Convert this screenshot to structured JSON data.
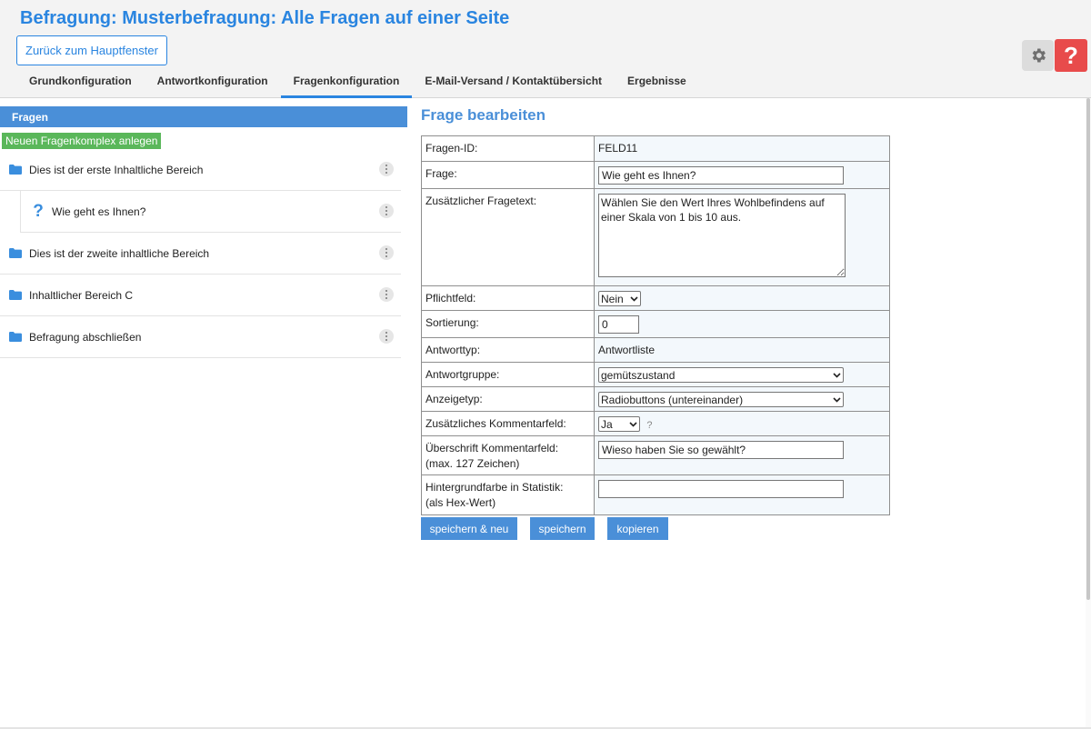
{
  "header": {
    "title": "Befragung: Musterbefragung: Alle Fragen auf einer Seite",
    "back_button": "Zurück zum Hauptfenster",
    "help_label": "?",
    "tabs": [
      {
        "label": "Grundkonfiguration",
        "active": false
      },
      {
        "label": "Antwortkonfiguration",
        "active": false
      },
      {
        "label": "Fragenkonfiguration",
        "active": true
      },
      {
        "label": "E-Mail-Versand / Kontaktübersicht",
        "active": false
      },
      {
        "label": "Ergebnisse",
        "active": false
      }
    ]
  },
  "sidebar": {
    "title": "Fragen",
    "new_button": "Neuen Fragenkomplex anlegen",
    "items": [
      {
        "label": "Dies ist der erste Inhaltliche Bereich",
        "icon": "folder-icon"
      },
      {
        "label": "Wie geht es Ihnen?",
        "icon": "question-icon",
        "child": true,
        "glyph": "?"
      },
      {
        "label": "Dies ist der zweite inhaltliche Bereich",
        "icon": "folder-icon"
      },
      {
        "label": "Inhaltlicher Bereich C",
        "icon": "folder-icon"
      },
      {
        "label": "Befragung abschließen",
        "icon": "folder-icon"
      }
    ]
  },
  "editor": {
    "title": "Frage bearbeiten",
    "rows": {
      "id": {
        "label": "Fragen-ID:",
        "value": "FELD11"
      },
      "question": {
        "label": "Frage:",
        "value": "Wie geht es Ihnen?"
      },
      "extra_text": {
        "label": "Zusätzlicher Fragetext:",
        "value": "Wählen Sie den Wert Ihres Wohlbefindens auf einer Skala von 1 bis 10 aus."
      },
      "required": {
        "label": "Pflichtfeld:",
        "value": "Nein"
      },
      "sorting": {
        "label": "Sortierung:",
        "value": "0"
      },
      "answer_type": {
        "label": "Antworttyp:",
        "value": "Antwortliste"
      },
      "answer_group": {
        "label": "Antwortgruppe:",
        "value": "gemütszustand"
      },
      "display_type": {
        "label": "Anzeigetyp:",
        "value": "Radiobuttons (untereinander)"
      },
      "comment_field": {
        "label": "Zusätzliches Kommentarfeld:",
        "value": "Ja",
        "hint": "?"
      },
      "comment_heading": {
        "label_line1": "Überschrift Kommentarfeld:",
        "label_line2": "(max. 127 Zeichen)",
        "value": "Wieso haben Sie so gewählt?"
      },
      "bg_color": {
        "label_line1": "Hintergrundfarbe in Statistik:",
        "label_line2": "(als Hex-Wert)",
        "value": ""
      }
    },
    "buttons": {
      "save_new": "speichern & neu",
      "save": "speichern",
      "copy": "kopieren"
    }
  },
  "colors": {
    "accent": "#2a85e0",
    "sidebar_header": "#4a8fd8",
    "new_button": "#5ab75a",
    "help_button": "#e84b4b"
  }
}
